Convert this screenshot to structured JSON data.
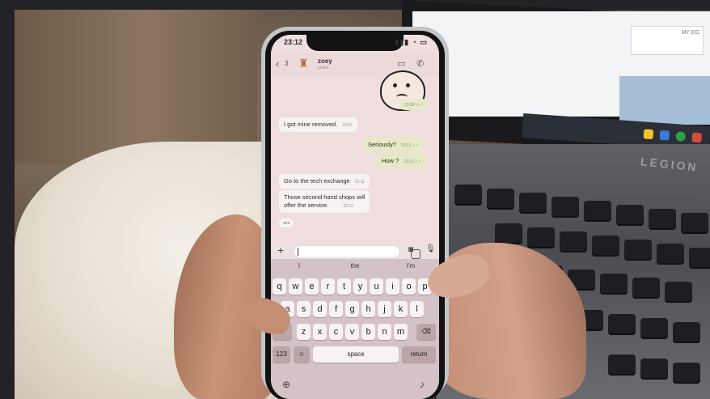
{
  "phone": {
    "status": {
      "time": "23:12",
      "icons": "▮▮▮ ◔ ▭"
    },
    "header": {
      "back_count": "3",
      "contact_name": "zoey",
      "contact_status": "online"
    },
    "messages": [
      {
        "text": "",
        "time": "23:08 ✓✓",
        "dir": "out"
      },
      {
        "text": "I got mine removed.",
        "time": "23:07",
        "dir": "in"
      },
      {
        "text": "Seriously?",
        "time": "23:11 ✓✓",
        "dir": "out"
      },
      {
        "text": "How ?",
        "time": "23:11 ✓✓",
        "dir": "out"
      },
      {
        "text": "Go to the tech exchange",
        "time": "23:11",
        "dir": "in"
      },
      {
        "text": "Those second hand shops will",
        "text2": "offer the service.",
        "time": "23:12",
        "dir": "in"
      }
    ],
    "typing": "•••",
    "suggestions": [
      "I",
      "the",
      "I'm"
    ],
    "keyboard": {
      "row1": [
        "q",
        "w",
        "e",
        "r",
        "t",
        "y",
        "u",
        "i",
        "o",
        "p"
      ],
      "row2": [
        "a",
        "s",
        "d",
        "f",
        "g",
        "h",
        "j",
        "k",
        "l"
      ],
      "row3": [
        "z",
        "x",
        "c",
        "v",
        "b",
        "n",
        "m"
      ],
      "num": "123",
      "space": "space",
      "return": "return"
    }
  },
  "laptop": {
    "brand": "LEGION",
    "field_text": "MY EG"
  }
}
